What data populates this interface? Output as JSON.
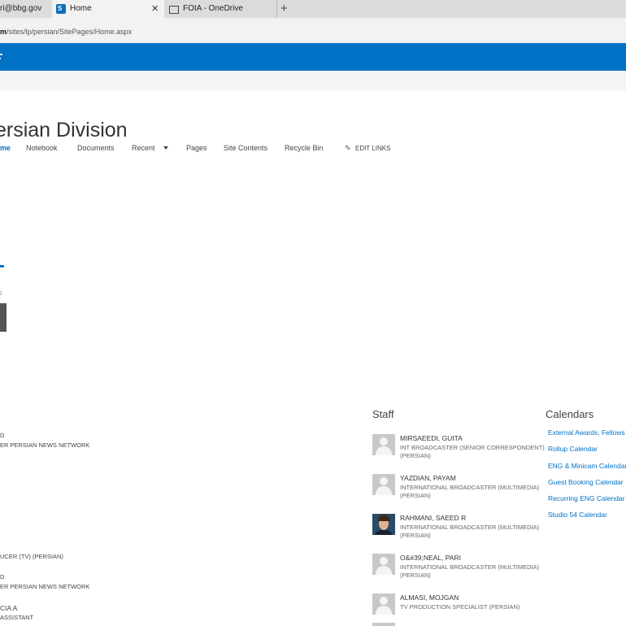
{
  "browser": {
    "tabs": [
      {
        "label": "ri@bbg.gov"
      },
      {
        "label": "Home"
      },
      {
        "label": "FOIA - OneDrive"
      }
    ],
    "new_tab_symbol": "+",
    "close_symbol": "✕",
    "address_bold": "m",
    "address_rest": "/sites/lp/persian/SitePages/Home.aspx"
  },
  "site": {
    "title": "ersian Division",
    "nav": [
      "me",
      "Notebook",
      "Documents",
      "Recent",
      "Pages",
      "Site Contents",
      "Recycle Bin",
      "EDIT LINKS"
    ]
  },
  "left_fragments": [
    "D",
    "ER PERSIAN NEWS NETWORK",
    "UCER (TV) (PERSIAN)",
    "D",
    "ER PERSIAN NEWS NETWORK",
    "CIA A",
    "ASSISTANT"
  ],
  "staff": {
    "heading": "Staff",
    "people": [
      {
        "name": "MIRSAEEDI, GUITA",
        "title1": "INT BROADCASTER (SENIOR CORRESPONDENT)",
        "title2": "(PERSIAN)"
      },
      {
        "name": "YAZDIAN, PAYAM",
        "title1": "INTERNATIONAL BROADCASTER (MULTIMEDIA)",
        "title2": "(PERSIAN)"
      },
      {
        "name": "RAHMANI, SAEED R",
        "title1": "INTERNATIONAL BROADCASTER (MULTIMEDIA)",
        "title2": "(PERSIAN)"
      },
      {
        "name": "O&#39;NEAL, PARI",
        "title1": "INTERNATIONAL BROADCASTER (MULTIMEDIA)",
        "title2": "(PERSIAN)"
      },
      {
        "name": "ALMASI, MOJGAN",
        "title1": "TV PRODUCTION SPECIALIST (PERSIAN)",
        "title2": ""
      }
    ]
  },
  "calendars": {
    "heading": "Calendars",
    "links": [
      "External Awards, Fellows",
      "Rollup Calendar",
      "ENG & Minicam Calendar",
      "Guest Booking Calendar",
      "Recurring ENG Calendar",
      "Studio 54 Calendar"
    ]
  },
  "colors": {
    "suite_bar": "#0072c6",
    "link": "#0072c6"
  },
  "icons": {
    "sharepoint": "sharepoint-icon",
    "onedrive": "onedrive-icon",
    "edit": "pencil-icon"
  }
}
